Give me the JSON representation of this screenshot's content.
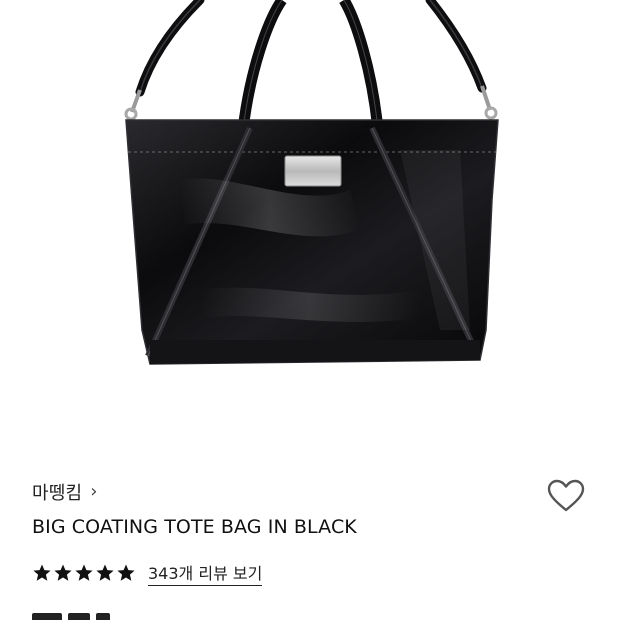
{
  "product": {
    "brand": "마뗑킴",
    "brand_chevron": "›",
    "name": "BIG COATING TOTE BAG IN BLACK",
    "rating_stars": 5,
    "review_link": "343개 리뷰 보기",
    "image_icon": "black-tote-bag-photo",
    "wishlist_icon": "heart-outline-icon"
  },
  "colors": {
    "text": "#111111",
    "star": "#111111",
    "heart": "#555555",
    "bag": "#0d0d0f"
  }
}
